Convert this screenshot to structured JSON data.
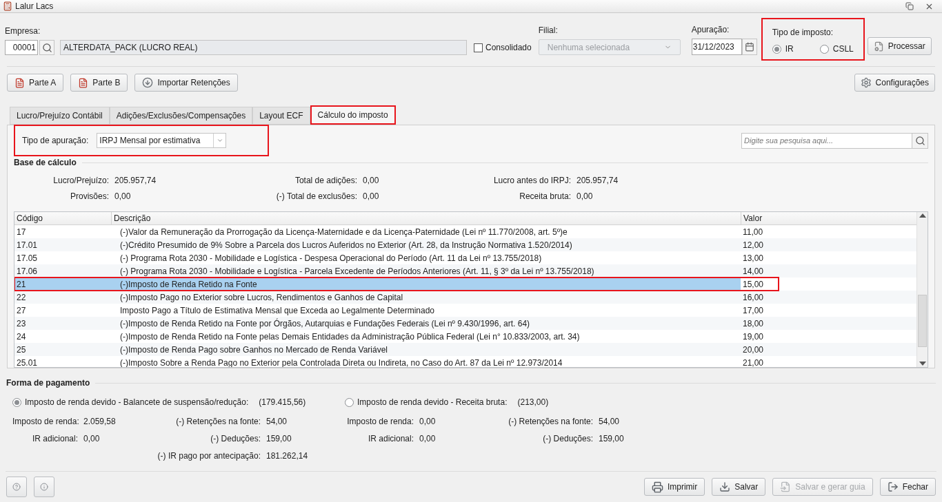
{
  "window": {
    "title": "Lalur Lacs"
  },
  "header": {
    "empresa": {
      "label": "Empresa:",
      "code": "00001",
      "name": "ALTERDATA_PACK (LUCRO REAL)"
    },
    "consolidado": {
      "label": "Consolidado",
      "checked": false
    },
    "filial": {
      "label": "Filial:",
      "value": "Nenhuma selecionada",
      "disabled": true
    },
    "apuracao": {
      "label": "Apuração:",
      "value": "31/12/2023"
    },
    "tipo_imposto": {
      "label": "Tipo de imposto:",
      "highlighted": true,
      "options": [
        {
          "label": "IR",
          "selected": true
        },
        {
          "label": "CSLL",
          "selected": false
        }
      ]
    },
    "process_button": "Processar"
  },
  "toolbar": {
    "buttons": [
      {
        "label": "Parte A",
        "kind": "parte-a"
      },
      {
        "label": "Parte B",
        "kind": "parte-b"
      },
      {
        "label": "Importar Retenções",
        "kind": "import"
      }
    ],
    "settings_button": "Configurações"
  },
  "tabs": [
    {
      "label": "Lucro/Prejuízo Contábil",
      "selected": false,
      "highlighted": false
    },
    {
      "label": "Adições/Exclusões/Compensações",
      "selected": false,
      "highlighted": false
    },
    {
      "label": "Layout ECF",
      "selected": false,
      "highlighted": false
    },
    {
      "label": "Cálculo do imposto",
      "selected": true,
      "highlighted": true
    }
  ],
  "tipo_apuracao": {
    "label": "Tipo de apuração:",
    "value": "IRPJ Mensal por estimativa",
    "highlighted": true
  },
  "search": {
    "placeholder": "Digite sua pesquisa aqui..."
  },
  "base_calculo": {
    "title": "Base de cálculo",
    "columns": [
      [
        {
          "label": "Lucro/Prejuízo:",
          "value": "205.957,74"
        },
        {
          "label": "Provisões:",
          "value": "0,00"
        }
      ],
      [
        {
          "label": "Total de adições:",
          "value": "0,00"
        },
        {
          "label": "(-) Total de exclusões:",
          "value": "0,00"
        }
      ],
      [
        {
          "label": "Lucro antes do IRPJ:",
          "value": "205.957,74"
        },
        {
          "label": "Receita bruta:",
          "value": "0,00"
        }
      ]
    ]
  },
  "table": {
    "columns": [
      "Código",
      "Descrição",
      "Valor"
    ],
    "rows": [
      {
        "code": "17",
        "description": "(-)Valor da Remuneração da Prorrogação da Licença-Maternidade e da Licença-Paternidade (Lei nº 11.770/2008, art. 5º)e",
        "value": "11,00",
        "selected": false,
        "highlighted": false
      },
      {
        "code": "17.01",
        "description": "(-)Crédito Presumido de 9% Sobre a Parcela dos Lucros Auferidos no Exterior (Art. 28, da Instrução Normativa 1.520/2014)",
        "value": "12,00",
        "selected": false,
        "highlighted": false
      },
      {
        "code": "17.05",
        "description": "(-) Programa Rota 2030 - Mobilidade e Logística - Despesa Operacional do Período (Art. 11 da Lei nº 13.755/2018)",
        "value": "13,00",
        "selected": false,
        "highlighted": false
      },
      {
        "code": "17.06",
        "description": "(-) Programa Rota 2030 - Mobilidade e Logística - Parcela Excedente de Períodos Anteriores (Art. 11, § 3º da Lei nº 13.755/2018)",
        "value": "14,00",
        "selected": false,
        "highlighted": false
      },
      {
        "code": "21",
        "description": "(-)Imposto de Renda Retido na Fonte",
        "value": "15,00",
        "selected": true,
        "highlighted": true
      },
      {
        "code": "22",
        "description": "(-)Imposto Pago no Exterior sobre Lucros, Rendimentos e Ganhos de Capital",
        "value": "16,00",
        "selected": false,
        "highlighted": false
      },
      {
        "code": "27",
        "description": "Imposto Pago a Título de Estimativa Mensal que Exceda ao Legalmente Determinado",
        "value": "17,00",
        "selected": false,
        "highlighted": false
      },
      {
        "code": "23",
        "description": "(-)Imposto de Renda Retido na Fonte por Órgãos, Autarquias e Fundações Federais (Lei nº 9.430/1996, art. 64)",
        "value": "18,00",
        "selected": false,
        "highlighted": false
      },
      {
        "code": "24",
        "description": "(-)Imposto de Renda Retido na Fonte pelas Demais Entidades da Administração Pública Federal (Lei n° 10.833/2003, art. 34)",
        "value": "19,00",
        "selected": false,
        "highlighted": false
      },
      {
        "code": "25",
        "description": "(-)Imposto de Renda Pago sobre Ganhos no Mercado de Renda Variável",
        "value": "20,00",
        "selected": false,
        "highlighted": false
      },
      {
        "code": "25.01",
        "description": "(-)Imposto Sobre a Renda Pago no Exterior pela Controlada Direta ou Indireta, no Caso do Art. 87 da Lei nº 12.973/2014",
        "value": "21,00",
        "selected": false,
        "highlighted": false
      }
    ]
  },
  "forma_pagamento": {
    "title": "Forma de pagamento",
    "options": [
      {
        "label": "Imposto de renda devido - Balancete de suspensão/redução:",
        "total": "(179.415,56)",
        "selected": true,
        "columns": [
          [
            {
              "label": "Imposto de renda:",
              "value": "2.059,58"
            },
            {
              "label": "IR adicional:",
              "value": "0,00"
            }
          ],
          [
            {
              "label": "(-) Retenções na fonte:",
              "value": "54,00"
            },
            {
              "label": "(-) Deduções:",
              "value": "159,00"
            },
            {
              "label": "(-) IR pago por antecipação:",
              "value": "181.262,14"
            }
          ]
        ]
      },
      {
        "label": "Imposto de renda devido - Receita bruta:",
        "total": "(213,00)",
        "selected": false,
        "columns": [
          [
            {
              "label": "Imposto de renda:",
              "value": "0,00"
            },
            {
              "label": "IR adicional:",
              "value": "0,00"
            }
          ],
          [
            {
              "label": "(-) Retenções na fonte:",
              "value": "54,00"
            },
            {
              "label": "(-) Deduções:",
              "value": "159,00"
            }
          ]
        ]
      }
    ]
  },
  "footer": {
    "buttons": [
      {
        "label": "Imprimir",
        "kind": "print",
        "disabled": false
      },
      {
        "label": "Salvar",
        "kind": "save",
        "disabled": false
      },
      {
        "label": "Salvar e gerar guia",
        "kind": "save-guide",
        "disabled": true
      },
      {
        "label": "Fechar",
        "kind": "close",
        "disabled": false
      }
    ]
  }
}
